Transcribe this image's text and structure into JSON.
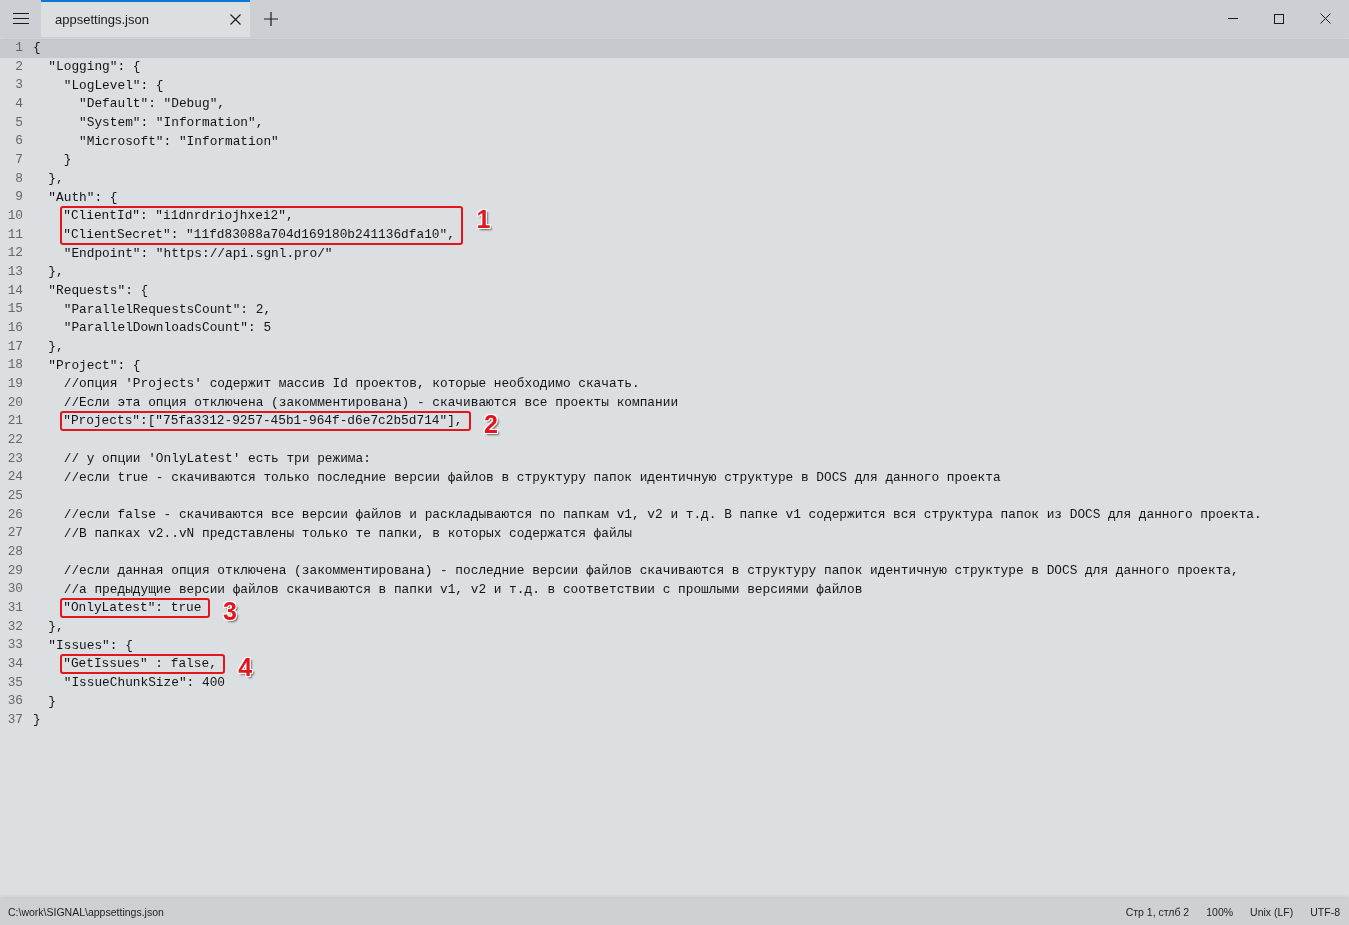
{
  "title_bar": {
    "tabs": [
      {
        "label": "appsettings.json",
        "selected": true
      }
    ]
  },
  "editor": {
    "lines": [
      {
        "kind": "line",
        "number": "1",
        "text": "{",
        "current": true
      },
      {
        "kind": "line",
        "number": "2",
        "text": "  \"Logging\": {",
        "current": false
      },
      {
        "kind": "line",
        "number": "3",
        "text": "    \"LogLevel\": {",
        "current": false
      },
      {
        "kind": "line",
        "number": "4",
        "text": "      \"Default\": \"Debug\",",
        "current": false
      },
      {
        "kind": "line",
        "number": "5",
        "text": "      \"System\": \"Information\",",
        "current": false
      },
      {
        "kind": "line",
        "number": "6",
        "text": "      \"Microsoft\": \"Information\"",
        "current": false
      },
      {
        "kind": "line",
        "number": "7",
        "text": "    }",
        "current": false
      },
      {
        "kind": "line",
        "number": "8",
        "text": "  },",
        "current": false
      },
      {
        "kind": "line",
        "number": "9",
        "text": "  \"Auth\": {",
        "current": false
      },
      {
        "kind": "callout",
        "label": "1",
        "lines": [
          {
            "number": "10",
            "text": "    \"ClientId\": \"i1dnrdriojhxei2\",",
            "current": false
          },
          {
            "number": "11",
            "text": "    \"ClientSecret\": \"11fd83088a704d169180b241136dfa10\",",
            "current": false
          }
        ]
      },
      {
        "kind": "line",
        "number": "12",
        "text": "    \"Endpoint\": \"https://api.sgnl.pro/\"",
        "current": false
      },
      {
        "kind": "line",
        "number": "13",
        "text": "  },",
        "current": false
      },
      {
        "kind": "line",
        "number": "14",
        "text": "  \"Requests\": {",
        "current": false
      },
      {
        "kind": "line",
        "number": "15",
        "text": "    \"ParallelRequestsCount\": 2,",
        "current": false
      },
      {
        "kind": "line",
        "number": "16",
        "text": "    \"ParallelDownloadsCount\": 5",
        "current": false
      },
      {
        "kind": "line",
        "number": "17",
        "text": "  },",
        "current": false
      },
      {
        "kind": "line",
        "number": "18",
        "text": "  \"Project\": {",
        "current": false
      },
      {
        "kind": "line",
        "number": "19",
        "text": "    //опция 'Projects' содержит массив Id проектов, которые необходимо скачать.",
        "current": false
      },
      {
        "kind": "line",
        "number": "20",
        "text": "    //Если эта опция отключена (закомментирована) - скачиваются все проекты компании",
        "current": false
      },
      {
        "kind": "callout",
        "label": "2",
        "lines": [
          {
            "number": "21",
            "text": "    \"Projects\":[\"75fa3312-9257-45b1-964f-d6e7c2b5d714\"],",
            "current": false
          }
        ]
      },
      {
        "kind": "line",
        "number": "22",
        "current": false
      },
      {
        "kind": "line",
        "number": "23",
        "text": "    // у опции 'OnlyLatest' есть три режима:",
        "current": false
      },
      {
        "kind": "line",
        "number": "24",
        "text": "    //если true - скачиваются только последние версии файлов в структуру папок идентичную структуре в DOCS для данного проекта",
        "current": false
      },
      {
        "kind": "line",
        "number": "25",
        "current": false
      },
      {
        "kind": "line",
        "number": "26",
        "text": "    //если false - скачиваются все версии файлов и раскладываются по папкам v1, v2 и т.д. В папке v1 содержится вся структура папок из DOCS для данного проекта.",
        "current": false
      },
      {
        "kind": "line",
        "number": "27",
        "text": "    //В папках v2..vN представлены только те папки, в которых содержатся файлы",
        "current": false
      },
      {
        "kind": "line",
        "number": "28",
        "current": false
      },
      {
        "kind": "line",
        "number": "29",
        "text": "    //если данная опция отключена (закомментирована) - последние версии файлов скачиваются в структуру папок идентичную структуре в DOCS для данного проекта,",
        "current": false
      },
      {
        "kind": "line",
        "number": "30",
        "text": "    //а предыдущие версии файлов скачиваются в папки v1, v2 и т.д. в соответствии с прошлыми версиями файлов",
        "current": false
      },
      {
        "kind": "callout",
        "label": "3",
        "lines": [
          {
            "number": "31",
            "text": "    \"OnlyLatest\": true",
            "current": false
          }
        ]
      },
      {
        "kind": "line",
        "number": "32",
        "text": "  },",
        "current": false
      },
      {
        "kind": "line",
        "number": "33",
        "text": "  \"Issues\": {",
        "current": false
      },
      {
        "kind": "callout",
        "label": "4",
        "lines": [
          {
            "number": "34",
            "text": "    \"GetIssues\" : false,",
            "current": false
          }
        ]
      },
      {
        "kind": "line",
        "number": "35",
        "text": "    \"IssueChunkSize\": 400",
        "current": false
      },
      {
        "kind": "line",
        "number": "36",
        "text": "  }",
        "current": false
      },
      {
        "kind": "line",
        "number": "37",
        "text": "}",
        "current": false
      }
    ]
  },
  "status_bar": {
    "file_path": "C:\\work\\SIGNAL\\appsettings.json",
    "items": [
      "Стр 1, стлб 2",
      "100%",
      "Unix (LF)",
      "UTF-8"
    ]
  }
}
